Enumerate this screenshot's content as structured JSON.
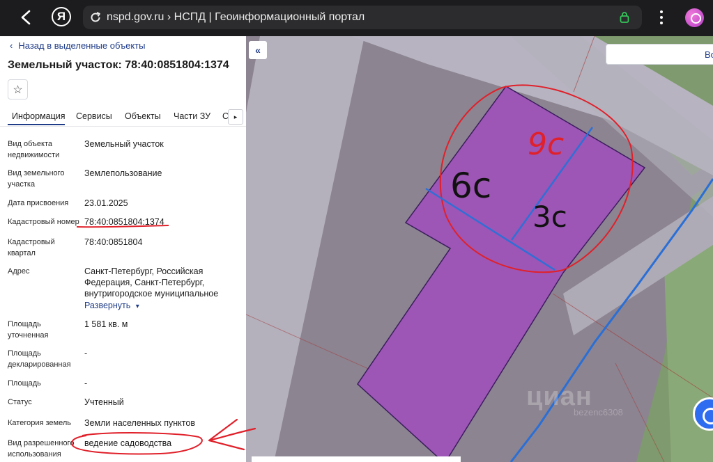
{
  "browser": {
    "url_text": "nspd.gov.ru › НСПД | Геоинформационный портал",
    "yandex_label": "Я"
  },
  "panel": {
    "back_link": "Назад в выделенные объекты",
    "title": "Земельный участок: 78:40:0851804:1374",
    "tabs": [
      "Информация",
      "Сервисы",
      "Объекты",
      "Части ЗУ",
      "С"
    ],
    "rows": [
      {
        "label": "Вид объекта недвижимости",
        "value": "Земельный участок"
      },
      {
        "label": "Вид земельного участка",
        "value": "Землепользование"
      },
      {
        "label": "Дата присвоения",
        "value": "23.01.2025"
      },
      {
        "label": "Кадастровый номер",
        "value": "78:40:0851804:1374"
      },
      {
        "label": "Кадастровый квартал",
        "value": "78:40:0851804"
      },
      {
        "label": "Адрес",
        "value": "Санкт-Петербург, Российская Федерация, Санкт-Петербург, внутригородское муниципальное"
      },
      {
        "label": "Площадь уточненная",
        "value": "1 581 кв. м"
      },
      {
        "label": "Площадь декларированная",
        "value": "-"
      },
      {
        "label": "Площадь",
        "value": "-"
      },
      {
        "label": "Статус",
        "value": "Учтенный"
      },
      {
        "label": "Категория земель",
        "value": "Земли населенных пунктов"
      },
      {
        "label": "Вид разрешенного использования",
        "value": "ведение садоводства"
      }
    ],
    "expand_link": "Развернуть"
  },
  "map": {
    "search_text": "Во",
    "watermark": "циан",
    "watermark_sub": "bezenc6308"
  },
  "annotations": {
    "top_label": "9с",
    "left_label": "6с",
    "right_label": "3с"
  },
  "colors": {
    "accent": "#1f3c88",
    "parcel_fill": "#9d56b5",
    "annotation_red": "#e0202a",
    "annotation_blue": "#2f6fd6"
  }
}
